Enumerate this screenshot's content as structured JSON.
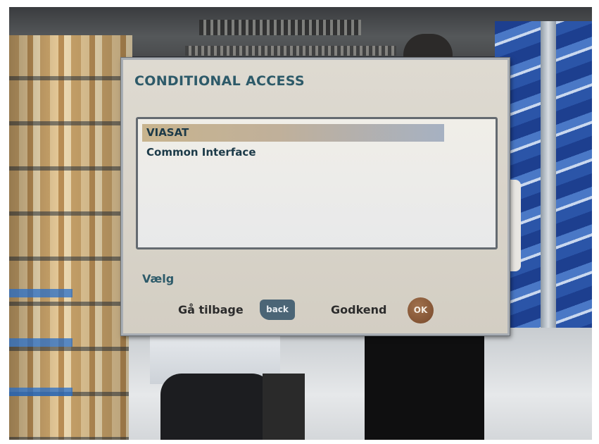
{
  "dialog": {
    "title": "CONDITIONAL ACCESS",
    "items": [
      {
        "label": "VIASAT",
        "selected": true
      },
      {
        "label": "Common Interface",
        "selected": false
      }
    ],
    "hint": "Vælg",
    "actions": {
      "back_label": "Gå tilbage",
      "back_key": "back",
      "confirm_label": "Godkend",
      "confirm_key": "OK"
    }
  },
  "colors": {
    "title_text": "#2d5a69",
    "panel_background": "#dad5cb",
    "selection_highlight": "#c8b48e",
    "back_key": "#4b6576",
    "ok_key": "#845535"
  }
}
